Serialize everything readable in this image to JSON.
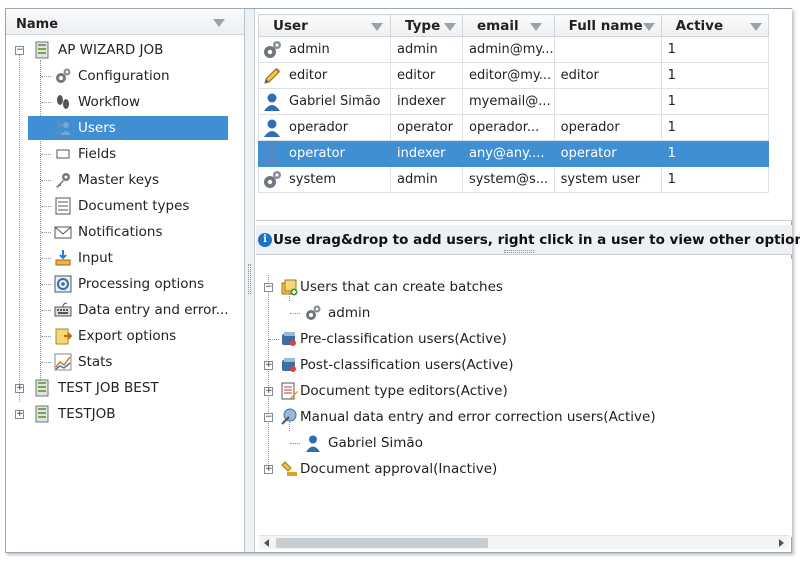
{
  "left_panel": {
    "column_header": "Name",
    "tree": [
      {
        "label": "AP WIZARD JOB",
        "icon": "job-icon",
        "expanded": true,
        "children": [
          {
            "label": "Configuration",
            "icon": "gears-icon"
          },
          {
            "label": "Workflow",
            "icon": "footprints-icon"
          },
          {
            "label": "Users",
            "icon": "users-icon",
            "selected": true
          },
          {
            "label": "Fields",
            "icon": "field-icon"
          },
          {
            "label": "Master keys",
            "icon": "key-icon"
          },
          {
            "label": "Document types",
            "icon": "document-types-icon"
          },
          {
            "label": "Notifications",
            "icon": "envelope-icon"
          },
          {
            "label": "Input",
            "icon": "input-tray-icon"
          },
          {
            "label": "Processing options",
            "icon": "processing-icon"
          },
          {
            "label": "Data entry and error...",
            "icon": "keyboard-icon"
          },
          {
            "label": "Export options",
            "icon": "export-icon"
          },
          {
            "label": "Stats",
            "icon": "stats-chart-icon"
          }
        ]
      },
      {
        "label": "TEST JOB BEST",
        "icon": "job-icon",
        "expanded": false
      },
      {
        "label": "TESTJOB",
        "icon": "job-icon",
        "expanded": false
      }
    ]
  },
  "users_grid": {
    "columns": [
      "User",
      "Type",
      "email",
      "Full name",
      "Active"
    ],
    "rows": [
      {
        "user": "admin",
        "type": "admin",
        "email": "admin@my...",
        "full_name": "",
        "active": "1",
        "icon": "gear-user-icon"
      },
      {
        "user": "editor",
        "type": "editor",
        "email": "editor@my...",
        "full_name": "editor",
        "active": "1",
        "icon": "pencil-user-icon"
      },
      {
        "user": "Gabriel Simão",
        "type": "indexer",
        "email": "myemail@...",
        "full_name": "",
        "active": "1",
        "icon": "person-icon"
      },
      {
        "user": "operador",
        "type": "operator",
        "email": "operador...",
        "full_name": "operador",
        "active": "1",
        "icon": "person-icon"
      },
      {
        "user": "operator",
        "type": "indexer",
        "email": "any@any....",
        "full_name": "operator",
        "active": "1",
        "icon": "person-icon",
        "selected": true
      },
      {
        "user": "system",
        "type": "admin",
        "email": "system@s...",
        "full_name": "system user",
        "active": "1",
        "icon": "gear-user-icon"
      }
    ]
  },
  "info_bar": {
    "text": "Use drag&drop to add users, right click in a user to view other options"
  },
  "roles_tree": [
    {
      "label": "Users that can create batches",
      "expanded": true,
      "icon": "create-batch-icon",
      "children": [
        {
          "label": "admin",
          "icon": "gear-user-icon"
        }
      ]
    },
    {
      "label": "Pre-classification users(Active)",
      "expanded": null,
      "icon": "classification-icon"
    },
    {
      "label": "Post-classification users(Active)",
      "expanded": false,
      "icon": "classification-icon"
    },
    {
      "label": "Document type editors(Active)",
      "expanded": false,
      "icon": "doc-editor-icon"
    },
    {
      "label": "Manual data entry and error correction users(Active)",
      "expanded": true,
      "icon": "data-entry-icon",
      "children": [
        {
          "label": "Gabriel Simão",
          "icon": "person-icon"
        }
      ]
    },
    {
      "label": "Document approval(Inactive)",
      "expanded": false,
      "icon": "approval-stamp-icon"
    }
  ],
  "colors": {
    "selection": "#3f8fd2",
    "info_icon": "#1a73c8"
  }
}
